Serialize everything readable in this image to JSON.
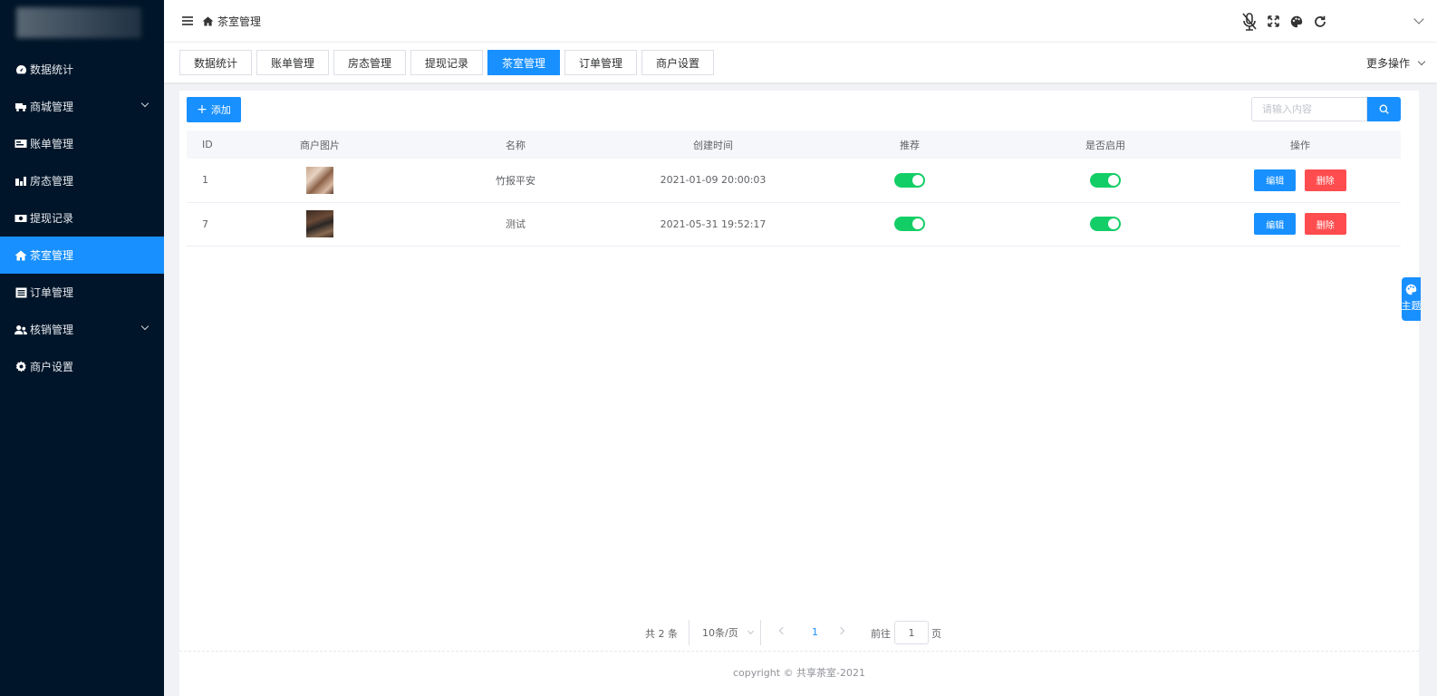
{
  "sidebar": {
    "items": [
      {
        "label": "数据统计",
        "icon": "dashboard-icon",
        "active": false,
        "expandable": false
      },
      {
        "label": "商城管理",
        "icon": "shop-icon",
        "active": false,
        "expandable": true
      },
      {
        "label": "账单管理",
        "icon": "bill-icon",
        "active": false,
        "expandable": false
      },
      {
        "label": "房态管理",
        "icon": "building-icon",
        "active": false,
        "expandable": false
      },
      {
        "label": "提现记录",
        "icon": "cash-icon",
        "active": false,
        "expandable": false
      },
      {
        "label": "茶室管理",
        "icon": "home-icon",
        "active": true,
        "expandable": false
      },
      {
        "label": "订单管理",
        "icon": "order-list-icon",
        "active": false,
        "expandable": false
      },
      {
        "label": "核销管理",
        "icon": "users-icon",
        "active": false,
        "expandable": true
      },
      {
        "label": "商户设置",
        "icon": "gear-icon",
        "active": false,
        "expandable": false
      }
    ]
  },
  "header": {
    "breadcrumb": "茶室管理",
    "tools": [
      "mic-off-icon",
      "fullscreen-icon",
      "palette-icon",
      "refresh-icon"
    ]
  },
  "tabs": {
    "items": [
      {
        "label": "数据统计",
        "active": false
      },
      {
        "label": "账单管理",
        "active": false
      },
      {
        "label": "房态管理",
        "active": false
      },
      {
        "label": "提现记录",
        "active": false
      },
      {
        "label": "茶室管理",
        "active": true
      },
      {
        "label": "订单管理",
        "active": false
      },
      {
        "label": "商户设置",
        "active": false
      }
    ],
    "more_label": "更多操作"
  },
  "toolbar": {
    "add_label": "添加",
    "search_placeholder": "请输入内容"
  },
  "table": {
    "headers": [
      "ID",
      "商户图片",
      "名称",
      "创建时间",
      "推荐",
      "是否启用",
      "操作"
    ],
    "rows": [
      {
        "id": "1",
        "name": "竹报平安",
        "created": "2021-01-09 20:00:03",
        "recommend": true,
        "enabled": true
      },
      {
        "id": "7",
        "name": "测试",
        "created": "2021-05-31 19:52:17",
        "recommend": true,
        "enabled": true
      }
    ],
    "edit_label": "编辑",
    "delete_label": "删除"
  },
  "pagination": {
    "total_text": "共 2 条",
    "page_size_text": "10条/页",
    "current_page": "1",
    "goto_label": "前往",
    "goto_value": "1",
    "page_suffix": "页"
  },
  "footer": {
    "copyright": "copyright © 共享茶室-2021"
  },
  "theme_button": {
    "label": "主题"
  },
  "colors": {
    "sidebar_bg": "#001529",
    "accent": "#1890ff",
    "switch_on": "#13ce66",
    "danger": "#ff4d4f"
  }
}
